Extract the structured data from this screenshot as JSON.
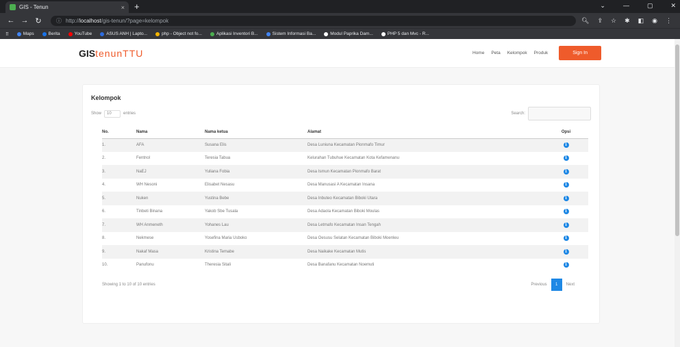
{
  "browser": {
    "tab_title": "GIS - Tenun",
    "tab_close": "×",
    "newtab": "+",
    "url_scheme": "http://",
    "url_host": "localhost",
    "url_path": "/gis-tenun/?page=kelompok",
    "bookmarks": [
      {
        "label": "Maps",
        "color": "#4285f4"
      },
      {
        "label": "Berita",
        "color": "#1a73e8"
      },
      {
        "label": "YouTube",
        "color": "#ff0000"
      },
      {
        "label": "ASUS ANH | Lapto...",
        "color": "#2d6cdf"
      },
      {
        "label": "php - Object not fo...",
        "color": "#f4b400"
      },
      {
        "label": "Aplikasi Inventori B...",
        "color": "#4caf50"
      },
      {
        "label": "Sistem Informasi Ba...",
        "color": "#4285f4"
      },
      {
        "label": "Modul Paprika Dam...",
        "color": "#ffffff"
      },
      {
        "label": "PHP 5 dan Mvc - R...",
        "color": "#ffffff"
      }
    ]
  },
  "nav": {
    "brand_prefix": "GIS",
    "brand_accent": "tenunTTU",
    "links": [
      "Home",
      "Peta",
      "Kelompok",
      "Produk"
    ],
    "signin": "Sign In"
  },
  "content": {
    "title": "Kelompok",
    "show_label": "Show",
    "show_value": "10",
    "entries_label": "entries",
    "search_label": "Search:",
    "columns": [
      "No.",
      "Nama",
      "Nama ketua",
      "Alamat",
      "Opsi"
    ],
    "rows": [
      {
        "no": "1.",
        "nama": "AFA",
        "ketua": "Susana Elis",
        "alamat": "Desa Luniuna Kecamatan Pionmafo Timur"
      },
      {
        "no": "2.",
        "nama": "Fentnol",
        "ketua": "Teresia Tabua",
        "alamat": "Kelurahan Tubuhue Kecamatan Kota Kefamenanu"
      },
      {
        "no": "3.",
        "nama": "NaEJ",
        "ketua": "Yuliana Fobia",
        "alamat": "Desa Ismun Kecamatan Pionmafo Barat"
      },
      {
        "no": "4.",
        "nama": "WH Nesoni",
        "ketua": "Elisabet Nesasu",
        "alamat": "Desa Manusasi A Kecamatan Insana"
      },
      {
        "no": "5.",
        "nama": "Nuken",
        "ketua": "Yustina Bebe",
        "alamat": "Desa Inbuteo Kecamatan Biboki Utara"
      },
      {
        "no": "6.",
        "nama": "Tinbeti Binana",
        "ketua": "Yakob Sbe Tusala",
        "alamat": "Desa Adaola Kecamatan Biboki Moulas"
      },
      {
        "no": "7.",
        "nama": "WH Anmeneth",
        "ketua": "Yohanes Lau",
        "alamat": "Desa Letmafo Kecamatan Insan Tengah"
      },
      {
        "no": "8.",
        "nama": "Nekmese",
        "ketua": "Yosefina Maria Usboko",
        "alamat": "Desa Oesusu Selatan Kecamatan Biboki Moenleu"
      },
      {
        "no": "9.",
        "nama": "Nakaf Masa",
        "ketua": "Kristina Temabe",
        "alamat": "Desa Naikake Kecamatan Mutis"
      },
      {
        "no": "10.",
        "nama": "Panufonu",
        "ketua": "Theresia Sitali",
        "alamat": "Desa Banafanu Kecamatan Noemuti"
      }
    ],
    "info_icon": "i",
    "showing": "Showing 1 to 10 of 10 entries",
    "previous": "Previous",
    "page": "1",
    "next": "Next"
  }
}
